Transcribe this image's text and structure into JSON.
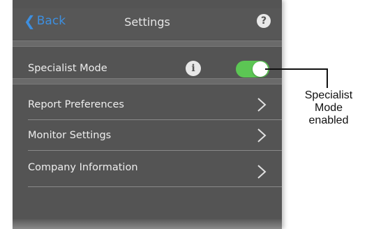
{
  "navbar": {
    "back_label": "Back",
    "back_icon": "chevron-left-icon",
    "title": "Settings",
    "help_label": "?"
  },
  "specialist_mode": {
    "label": "Specialist Mode",
    "info_label": "i",
    "enabled": true,
    "toggle_color": "#5cc654"
  },
  "menu_items": [
    {
      "label": "Report Preferences",
      "icon": "chevron-right-icon"
    },
    {
      "label": "Monitor Settings",
      "icon": "chevron-right-icon"
    },
    {
      "label": "Company Information",
      "icon": "chevron-right-icon"
    }
  ],
  "callout": {
    "line1": "Specialist",
    "line2": "Mode",
    "line3": "enabled"
  },
  "colors": {
    "accent": "#3d8fe0",
    "background": "#545454"
  }
}
